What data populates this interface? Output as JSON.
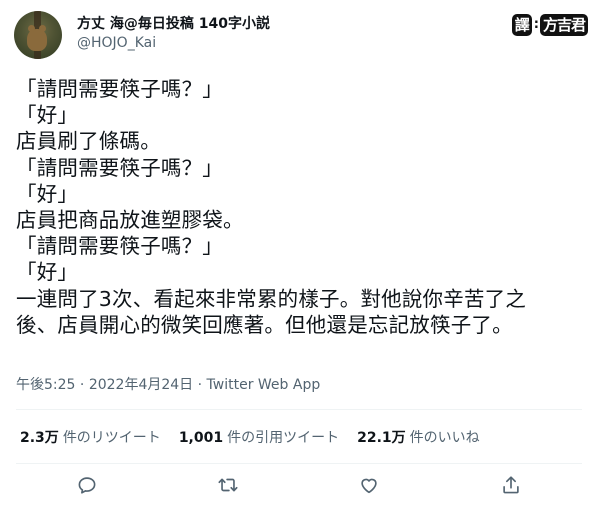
{
  "author": {
    "display_name": "方丈 海@毎日投稿 140字小説",
    "handle": "@HOJO_Kai"
  },
  "watermark": {
    "part1": "譯",
    "part2": "方吉君"
  },
  "tweet": {
    "text": "「請問需要筷子嗎？」\n「好」\n店員刷了條碼。\n「請問需要筷子嗎？」\n「好」\n店員把商品放進塑膠袋。\n「請問需要筷子嗎？」\n「好」\n一連問了3次、看起來非常累的樣子。對他說你辛苦了之\n後、店員開心的微笑回應著。但他還是忘記放筷子了。",
    "time": "午後5:25",
    "separator": " · ",
    "date": "2022年4月24日",
    "source": "Twitter Web App"
  },
  "stats": {
    "retweets_count": "2.3万",
    "retweets_label": "件のリツイート",
    "quotes_count": "1,001",
    "quotes_label": "件の引用ツイート",
    "likes_count": "22.1万",
    "likes_label": "件のいいね"
  },
  "colors": {
    "text": "#0f1419",
    "muted": "#536471",
    "divider": "#eff3f4"
  },
  "icons": [
    "reply-icon",
    "retweet-icon",
    "like-icon",
    "share-icon"
  ]
}
